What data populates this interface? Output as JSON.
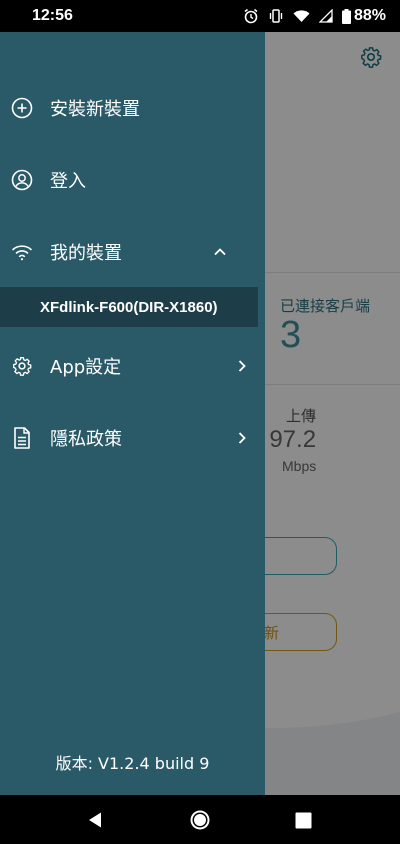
{
  "status_bar": {
    "time": "12:56",
    "battery": "88%",
    "icons": [
      "alarm-icon",
      "vibrate-icon",
      "wifi-icon",
      "signal-icon",
      "battery-icon"
    ]
  },
  "app_background": {
    "clients_label": "已連接客戶端",
    "clients_count": "3",
    "upload_label": "上傳",
    "upload_value": ". 97.2",
    "upload_unit": "Mbps",
    "update_button_partial": "新"
  },
  "drawer": {
    "items": [
      {
        "label": "安裝新裝置",
        "icon": "add-circle-icon"
      },
      {
        "label": "登入",
        "icon": "user-icon"
      },
      {
        "label": "我的裝置",
        "icon": "wifi-icon",
        "expanded": true
      },
      {
        "label": "App設定",
        "icon": "gear-icon"
      },
      {
        "label": "隱私政策",
        "icon": "document-icon"
      }
    ],
    "devices": [
      "XFdlink-F600(DIR-X1860)"
    ],
    "version": "版本: V1.2.4 build 9"
  },
  "colors": {
    "drawer_bg": "#2a5a68",
    "selected_device_bg": "#1d3e48",
    "accent_teal": "#3e8f9c",
    "accent_gold": "#d1a21c"
  }
}
